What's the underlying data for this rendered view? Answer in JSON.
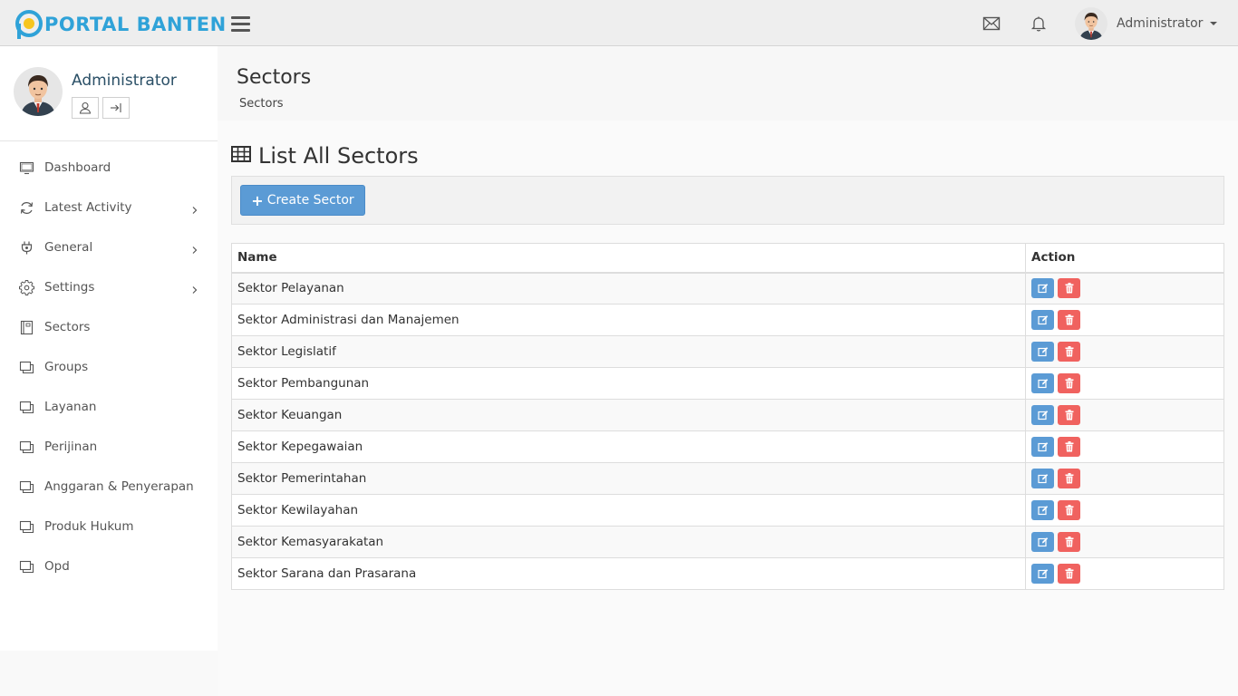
{
  "brand": {
    "name": "PORTAL BANTEN",
    "accent": "#2fa2d8",
    "mark_color": "#f7c51e"
  },
  "topbar": {
    "user_name": "Administrator",
    "icons": [
      "envelope-icon",
      "bell-icon"
    ]
  },
  "sidebar": {
    "profile_name": "Administrator",
    "items": [
      {
        "label": "Dashboard",
        "icon": "monitor-icon",
        "has_children": false
      },
      {
        "label": "Latest Activity",
        "icon": "refresh-icon",
        "has_children": true
      },
      {
        "label": "General",
        "icon": "plug-icon",
        "has_children": true
      },
      {
        "label": "Settings",
        "icon": "gear-icon",
        "has_children": true
      },
      {
        "label": "Sectors",
        "icon": "book-icon",
        "has_children": false
      },
      {
        "label": "Groups",
        "icon": "window-icon",
        "has_children": false
      },
      {
        "label": "Layanan",
        "icon": "window-icon",
        "has_children": false
      },
      {
        "label": "Perijinan",
        "icon": "window-icon",
        "has_children": false
      },
      {
        "label": "Anggaran & Penyerapan",
        "icon": "window-icon",
        "has_children": false
      },
      {
        "label": "Produk Hukum",
        "icon": "window-icon",
        "has_children": false
      },
      {
        "label": "Opd",
        "icon": "window-icon",
        "has_children": false
      }
    ]
  },
  "header": {
    "title": "Sectors",
    "breadcrumb": "Sectors"
  },
  "main": {
    "list_title": "List All Sectors",
    "create_label": "Create Sector",
    "columns": [
      "Name",
      "Action"
    ],
    "rows": [
      "Sektor Pelayanan",
      "Sektor Administrasi dan Manajemen",
      "Sektor Legislatif",
      "Sektor Pembangunan",
      "Sektor Keuangan",
      "Sektor Kepegawaian",
      "Sektor Pemerintahan",
      "Sektor Kewilayahan",
      "Sektor Kemasyarakatan",
      "Sektor Sarana dan Prasarana"
    ]
  },
  "colors": {
    "primary": "#5b9bd5",
    "danger": "#f0625f"
  }
}
